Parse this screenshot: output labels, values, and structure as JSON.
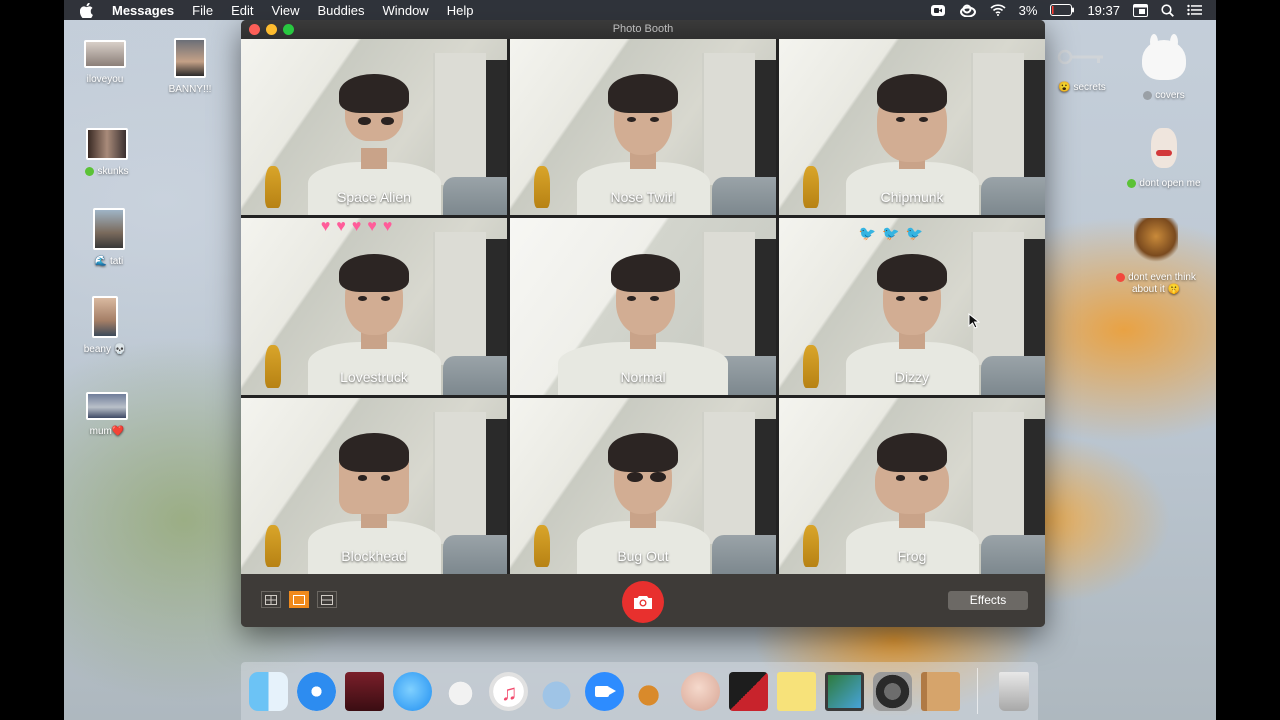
{
  "menubar": {
    "app_name": "Messages",
    "menus": [
      "File",
      "Edit",
      "View",
      "Buddies",
      "Window",
      "Help"
    ],
    "battery": "3%",
    "clock": "19:37",
    "status_icons": [
      "screen-record-icon",
      "creative-cloud-icon",
      "wifi-icon",
      "battery-icon",
      "calendar-icon",
      "search-icon",
      "menu-list-icon"
    ]
  },
  "window": {
    "title": "Photo Booth",
    "effects": [
      "Space Alien",
      "Nose Twirl",
      "Chipmunk",
      "Lovestruck",
      "Normal",
      "Dizzy",
      "Blockhead",
      "Bug Out",
      "Frog"
    ],
    "effects_button": "Effects",
    "selected_view": "single",
    "colors": {
      "shutter": "#e8302e",
      "selected_view": "#f08a1c"
    }
  },
  "desktop_icons": {
    "left": [
      {
        "label": "iloveyou",
        "dot": ""
      },
      {
        "label": "BANNY!!!",
        "dot": ""
      },
      {
        "label": "skunks",
        "dot": "green"
      },
      {
        "label": "tati",
        "dot": "wave"
      },
      {
        "label": "beany 💀",
        "dot": ""
      },
      {
        "label": "mum❤️",
        "dot": ""
      }
    ],
    "right": [
      {
        "label": "secrets",
        "dot": "emoji"
      },
      {
        "label": "covers",
        "dot": "gray"
      },
      {
        "label": "dont open me",
        "dot": "green"
      },
      {
        "label": "dont even think about it 🤫",
        "dot": "red"
      }
    ]
  },
  "dock": {
    "apps": [
      "finder-icon",
      "safari-icon",
      "photo-booth-icon",
      "messages-icon",
      "rabbit-app-icon",
      "music-icon",
      "seal-app-icon",
      "zoom-icon",
      "garageband-icon",
      "avatar-app-icon",
      "flashcards-icon",
      "stickies-icon",
      "preview-icon",
      "system-preferences-icon",
      "contacts-icon",
      "trash-icon"
    ]
  }
}
